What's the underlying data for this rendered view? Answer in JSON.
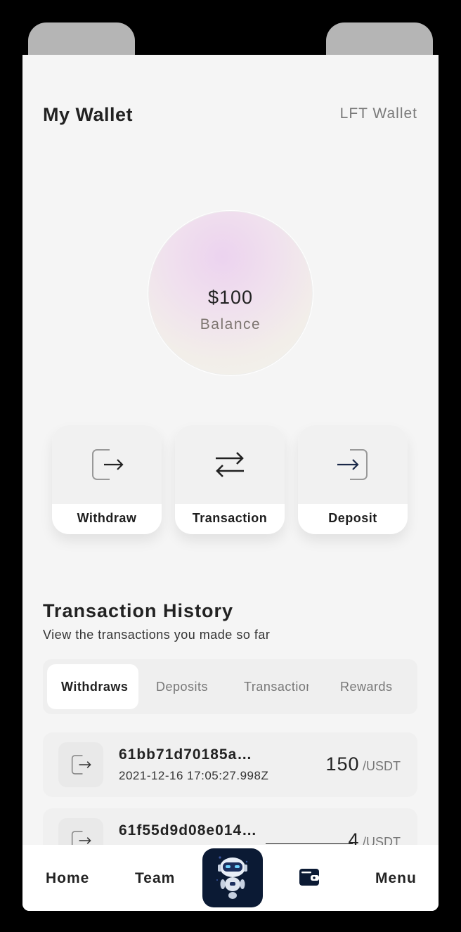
{
  "header": {
    "title": "My Wallet",
    "wallet_link": "LFT Wallet"
  },
  "balance": {
    "amount": "$100",
    "label": "Balance"
  },
  "actions": [
    {
      "label": "Withdraw",
      "icon": "withdraw-icon"
    },
    {
      "label": "Transaction",
      "icon": "transfer-arrows-icon"
    },
    {
      "label": "Deposit",
      "icon": "deposit-icon"
    }
  ],
  "history": {
    "title": "Transaction History",
    "subtitle": "View the transactions you made so far",
    "tabs": [
      "Withdraws",
      "Deposits",
      "Transactions",
      "Rewards"
    ],
    "active_tab": "Withdraws",
    "transactions": [
      {
        "id": "61bb71d70185a…",
        "date": "2021-12-16 17:05:27.998Z",
        "amount": "150",
        "unit": "/USDT"
      },
      {
        "id": "61f55d9d08e014…",
        "date": "",
        "amount": "4",
        "unit": "/USDT"
      }
    ]
  },
  "nav": {
    "home": "Home",
    "team": "Team",
    "menu": "Menu",
    "robot_icon": "robot-icon",
    "wallet_icon": "wallet-icon"
  },
  "colors": {
    "background": "#f5f5f5",
    "nav_robot_bg": "#0b1a34",
    "deposit_arrow": "#1a2848"
  }
}
